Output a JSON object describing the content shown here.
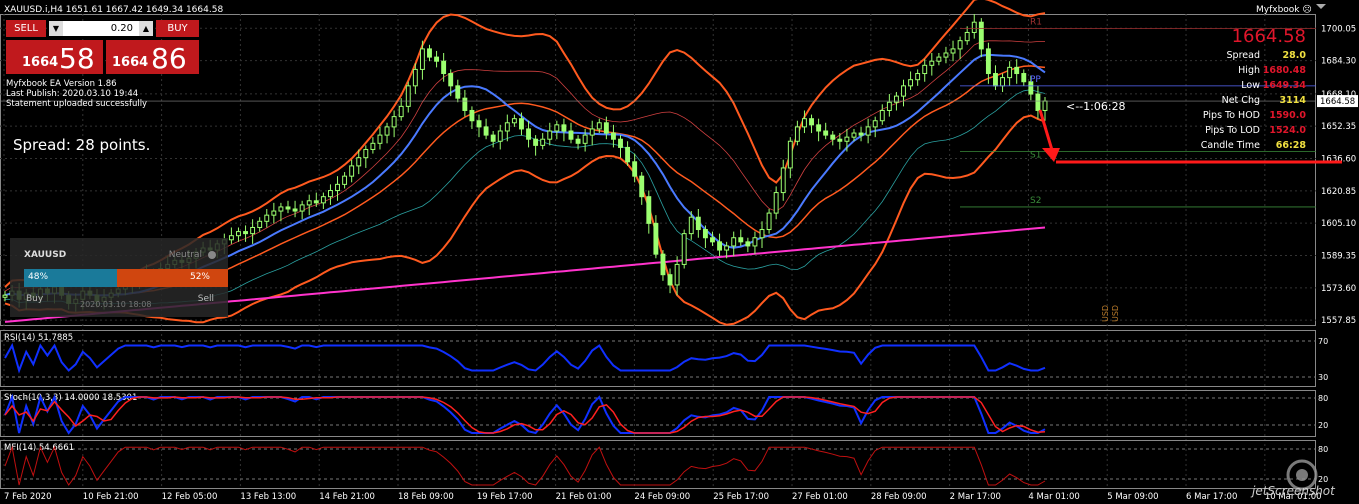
{
  "header": {
    "symbol_info": "XAUUSD.i,H4  1651.61 1667.42 1649.34 1664.58",
    "brand": "Myfxbook"
  },
  "trade": {
    "sell_label": "SELL",
    "buy_label": "BUY",
    "lot": "0.20",
    "sell_small": "1664",
    "sell_big": "58",
    "buy_small": "1664",
    "buy_big": "86"
  },
  "info": {
    "line1": "Myfxbook EA Version 1.86",
    "line2": "Last Publish: 2020.03.10 19:44",
    "line3": "Statement uploaded successfully"
  },
  "spread_note": "Spread: 28 points.",
  "sentiment": {
    "symbol": "XAUUSD",
    "status": "Neutral",
    "buy_pct": "48%",
    "sell_pct": "52%",
    "buy_label": "Buy",
    "sell_label": "Sell",
    "date": "2020.03.10 18:08",
    "buy_color": "#1a7a9a",
    "sell_color": "#d0460f"
  },
  "stats": {
    "price": "1664.58",
    "rows": [
      {
        "label": "Spread",
        "value": "28.0",
        "color": "#f0e040"
      },
      {
        "label": "High",
        "value": "1680.48",
        "color": "#e0162b"
      },
      {
        "label": "Low",
        "value": "1649.34",
        "color": "#e0162b"
      },
      {
        "label": "Net Chg",
        "value": "3114",
        "color": "#f0e040"
      },
      {
        "label": "Pips To HOD",
        "value": "1590.0",
        "color": "#e0162b"
      },
      {
        "label": "Pips To LOD",
        "value": "1524.0",
        "color": "#e0162b"
      },
      {
        "label": "Candle Time",
        "value": "66:28",
        "color": "#f0e040"
      }
    ]
  },
  "countdown": "<--1:06:28",
  "watermark": "jetScreenshot",
  "pivots": {
    "R1": "R1",
    "PP": "PP",
    "S1": "S1",
    "S2": "S2"
  },
  "chart_data": [
    {
      "type": "candlestick",
      "title": "XAUUSD.i,H4",
      "y_ticks": [
        1700.05,
        1684.3,
        1668.1,
        1652.35,
        1636.6,
        1620.85,
        1605.1,
        1589.35,
        1573.6,
        1557.85
      ],
      "current_price": 1664.58,
      "ylim": [
        1555,
        1707
      ],
      "x_ticks": [
        "7 Feb 2020",
        "10 Feb 21:00",
        "12 Feb 05:00",
        "13 Feb 13:00",
        "14 Feb 21:00",
        "18 Feb 09:00",
        "19 Feb 17:00",
        "21 Feb 01:00",
        "24 Feb 09:00",
        "25 Feb 17:00",
        "27 Feb 01:00",
        "28 Feb 09:00",
        "2 Mar 17:00",
        "4 Mar 01:00",
        "5 Mar 09:00",
        "6 Mar 17:00",
        "10 Mar 01:00"
      ],
      "close": [
        1570,
        1572,
        1568,
        1571,
        1569,
        1573,
        1571,
        1574,
        1570,
        1566,
        1568,
        1572,
        1570,
        1567,
        1569,
        1571,
        1573,
        1575,
        1578,
        1579,
        1581,
        1580,
        1583,
        1585,
        1587,
        1586,
        1588,
        1591,
        1593,
        1592,
        1595,
        1597,
        1599,
        1601,
        1600,
        1603,
        1606,
        1609,
        1611,
        1613,
        1612,
        1611,
        1614,
        1616,
        1615,
        1618,
        1621,
        1624,
        1628,
        1633,
        1637,
        1641,
        1644,
        1648,
        1652,
        1657,
        1662,
        1672,
        1680,
        1690,
        1686,
        1684,
        1678,
        1672,
        1666,
        1660,
        1655,
        1652,
        1648,
        1645,
        1650,
        1654,
        1656,
        1651,
        1646,
        1643,
        1646,
        1650,
        1653,
        1650,
        1646,
        1644,
        1648,
        1651,
        1654,
        1649,
        1646,
        1642,
        1635,
        1628,
        1618,
        1605,
        1590,
        1580,
        1575,
        1585,
        1600,
        1608,
        1602,
        1598,
        1596,
        1592,
        1594,
        1598,
        1596,
        1594,
        1598,
        1602,
        1610,
        1620,
        1632,
        1645,
        1652,
        1656,
        1653,
        1650,
        1648,
        1646,
        1645,
        1647,
        1649,
        1648,
        1652,
        1655,
        1660,
        1664,
        1667,
        1672,
        1675,
        1678,
        1682,
        1684,
        1686,
        1688,
        1690,
        1694,
        1698,
        1703,
        1690,
        1678,
        1672,
        1676,
        1681,
        1678,
        1674,
        1668,
        1660,
        1664.58
      ],
      "indicators": [
        "Bollinger Bands",
        "Moving Averages",
        "Pivot Points"
      ]
    },
    {
      "type": "line",
      "title": "RSI(14) 51.7885",
      "ylim": [
        0,
        100
      ],
      "levels": [
        30,
        70
      ]
    },
    {
      "type": "line",
      "title": "Stoch(10,3,3) 14.0000 18.5301",
      "ylim": [
        0,
        100
      ],
      "levels": [
        20,
        80
      ]
    },
    {
      "type": "line",
      "title": "MFI(14) 54.6661",
      "ylim": [
        0,
        100
      ],
      "levels": [
        20,
        80
      ]
    }
  ],
  "indicator_axis": {
    "rsi": [
      "70",
      "30"
    ],
    "stoch": [
      "80",
      "20"
    ],
    "mfi": [
      "80",
      "20"
    ]
  },
  "chart_marks": [
    "USD",
    "USD"
  ]
}
